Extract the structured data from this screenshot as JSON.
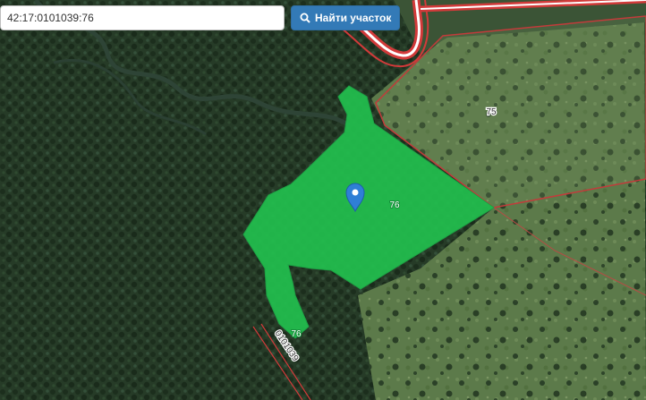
{
  "search": {
    "value": "42:17:0101039:76",
    "button_label": "Найти участок",
    "button_icon": "search-icon"
  },
  "map": {
    "parcels": [
      {
        "number": "76",
        "state": "selected",
        "fill_color": "#22c04e",
        "label_color": "#ffffff"
      },
      {
        "number": "75",
        "state": "neighbor",
        "border_color": "#c23b3b"
      }
    ],
    "quarter_label": "0101039",
    "marker_icon": "map-pin-icon",
    "marker_color": "#2f7fd6",
    "road_color": "#d23a3a"
  }
}
